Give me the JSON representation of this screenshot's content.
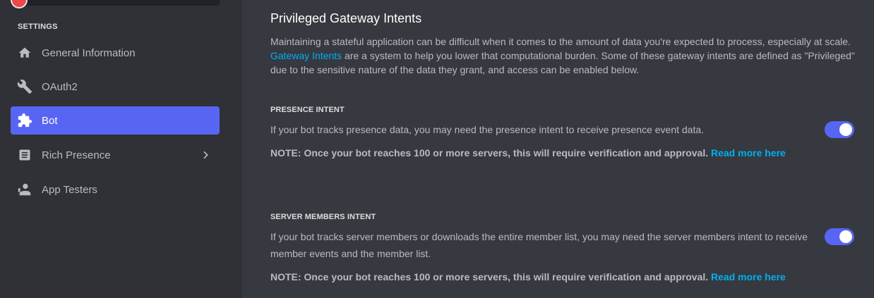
{
  "sidebar": {
    "section_label": "SETTINGS",
    "items": [
      {
        "label": "General Information",
        "icon": "home-icon"
      },
      {
        "label": "OAuth2",
        "icon": "wrench-icon"
      },
      {
        "label": "Bot",
        "icon": "puzzle-icon",
        "active": true
      },
      {
        "label": "Rich Presence",
        "icon": "document-icon",
        "has_submenu": true
      },
      {
        "label": "App Testers",
        "icon": "person-icon"
      }
    ]
  },
  "main": {
    "heading": "Privileged Gateway Intents",
    "description_before_link": "Maintaining a stateful application can be difficult when it comes to the amount of data you're expected to process, especially at scale. ",
    "description_link": "Gateway Intents",
    "description_after_link": " are a system to help you lower that computational burden. Some of these gateway intents are defined as \"Privileged\" due to the sensitive nature of the data they grant, and access can be enabled below.",
    "intents": [
      {
        "title": "PRESENCE INTENT",
        "description": "If your bot tracks presence data, you may need the presence intent to receive presence event data.",
        "note": "NOTE: Once your bot reaches 100 or more servers, this will require verification and approval.",
        "note_link": "Read more here",
        "enabled": true
      },
      {
        "title": "SERVER MEMBERS INTENT",
        "description": "If your bot tracks server members or downloads the entire member list, you may need the server members intent to receive member events and the member list.",
        "note": "NOTE: Once your bot reaches 100 or more servers, this will require verification and approval.",
        "note_link": "Read more here",
        "enabled": true
      }
    ]
  },
  "colors": {
    "sidebar_bg": "#2f3136",
    "content_bg": "#36393f",
    "accent": "#5865f2",
    "link": "#00aff4"
  }
}
